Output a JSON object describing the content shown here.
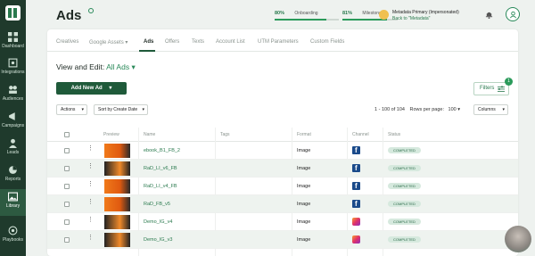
{
  "sidebar": {
    "items": [
      {
        "label": "Dashboard"
      },
      {
        "label": "Integrations"
      },
      {
        "label": "Audiences"
      },
      {
        "label": "Campaigns"
      },
      {
        "label": "Leads"
      },
      {
        "label": "Reports"
      },
      {
        "label": "Library"
      },
      {
        "label": "Playbooks"
      }
    ]
  },
  "header": {
    "title": "Ads",
    "onboarding": {
      "pct": "80%",
      "label": "Onboarding",
      "fill": 0.8
    },
    "milestones": {
      "pct": "81%",
      "label": "Milestones",
      "fill": 0.81
    },
    "account": {
      "name": "Metadata Primary (Impersonated)",
      "back": "Back to \"Metadata\""
    }
  },
  "tabs": [
    "Creatives",
    "Google Assets",
    "Ads",
    "Offers",
    "Texts",
    "Account List",
    "UTM Parameters",
    "Custom Fields"
  ],
  "google_assets_chevron": "▾",
  "view": {
    "prefix": "View and Edit:",
    "value": "All Ads",
    "chevron": "▾"
  },
  "add_button": "Add New Ad",
  "filters": {
    "label": "Filters",
    "badge": "1"
  },
  "toolbar": {
    "actions": "Actions",
    "sort": "Sort by Create Date",
    "range": "1 - 100 of 104",
    "rows_label": "Rows per page:",
    "rows_value": "100",
    "columns": "Columns"
  },
  "table": {
    "headers": [
      "Preview",
      "Name",
      "Tags",
      "Format",
      "Channel",
      "Status"
    ],
    "rows": [
      {
        "name": "ebook_B1_FB_2",
        "format": "Image",
        "channel": "facebook",
        "status": "COMPLETED"
      },
      {
        "name": "RaD_LI_v6_FB",
        "format": "Image",
        "channel": "facebook",
        "status": "COMPLETED"
      },
      {
        "name": "RaD_LI_v4_FB",
        "format": "Image",
        "channel": "facebook",
        "status": "COMPLETED"
      },
      {
        "name": "RaD_FB_v5",
        "format": "Image",
        "channel": "facebook",
        "status": "COMPLETED"
      },
      {
        "name": "Demo_IG_v4",
        "format": "Image",
        "channel": "instagram",
        "status": "COMPLETED"
      },
      {
        "name": "Demo_IG_v3",
        "format": "Image",
        "channel": "instagram",
        "status": "COMPLETED"
      }
    ]
  },
  "colors": {
    "accent": "#2a8a5a",
    "sidebar": "#1f3a2c",
    "primary_button": "#1f5a3a"
  }
}
